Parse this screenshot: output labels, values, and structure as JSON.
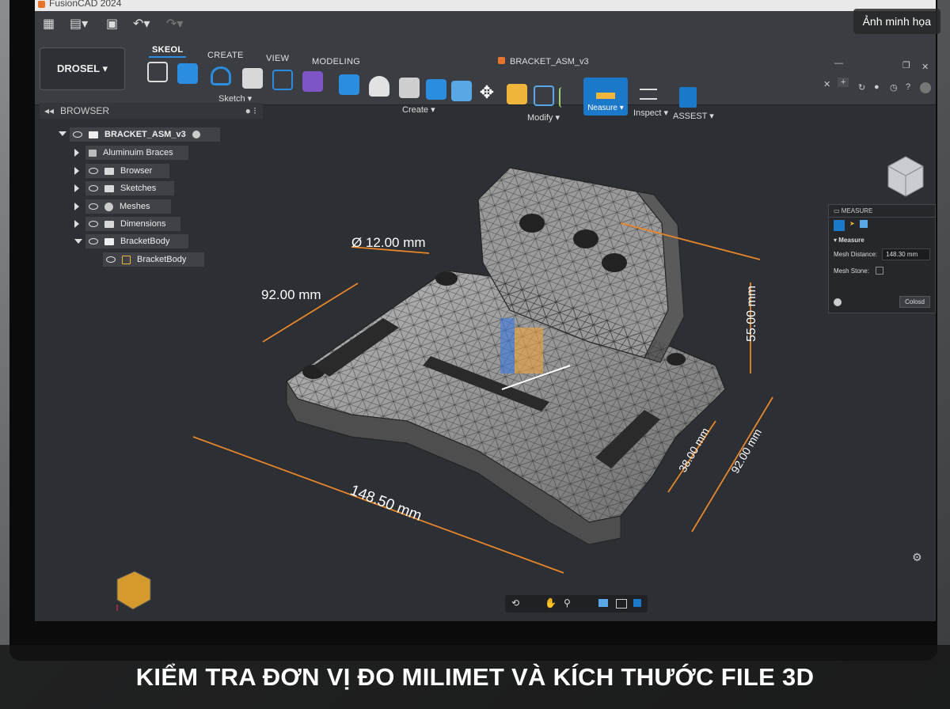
{
  "app": {
    "title": "FusionCAD 2024"
  },
  "workspace": {
    "label": "DROSEL ▾"
  },
  "tabs": [
    {
      "label": "SKEOL",
      "active": true
    },
    {
      "label": "CREATE"
    },
    {
      "label": "VIEW"
    },
    {
      "label": "MODELING"
    }
  ],
  "document": {
    "title": "BRACKET_ASM_v3"
  },
  "groups": {
    "sketch": "Sketch ▾",
    "create": "Create ▾",
    "modify": "Modify ▾",
    "measure": "Neasure ▾",
    "inspect": "Inspect ▾",
    "assest": "ASSEST ▾"
  },
  "browser": {
    "header": "BROWSER",
    "root": "BRACKET_ASM_v3",
    "items": [
      {
        "label": "Aluminuim Braces"
      },
      {
        "label": "Browser"
      },
      {
        "label": "Sketches"
      },
      {
        "label": "Meshes"
      },
      {
        "label": "Dimensions"
      },
      {
        "label": "BracketBody"
      },
      {
        "label": "BracketBody"
      }
    ]
  },
  "dimensions": {
    "hole_diameter": "Ø 12.00 mm",
    "width_left": "92.00 mm",
    "length": "148.50 mm",
    "height": "55.00 mm",
    "slot": "38.00 mm",
    "width_right": "92.00 mm"
  },
  "measure_panel": {
    "title": "MEASURE",
    "section": "Measure",
    "mesh_distance_label": "Mesh Distance:",
    "mesh_distance_value": "148.30 mm",
    "mesh_stone_label": "Mesh Stone:",
    "close_label": "Colosd"
  },
  "caption": "KIỂM TRA ĐƠN VỊ ĐO MILIMET VÀ KÍCH THƯỚC FILE 3D",
  "badge": "Ảnh minh họa",
  "colors": {
    "accent": "#1c78c9",
    "dimension": "#e8862a",
    "viewport": "#2c2f34"
  }
}
